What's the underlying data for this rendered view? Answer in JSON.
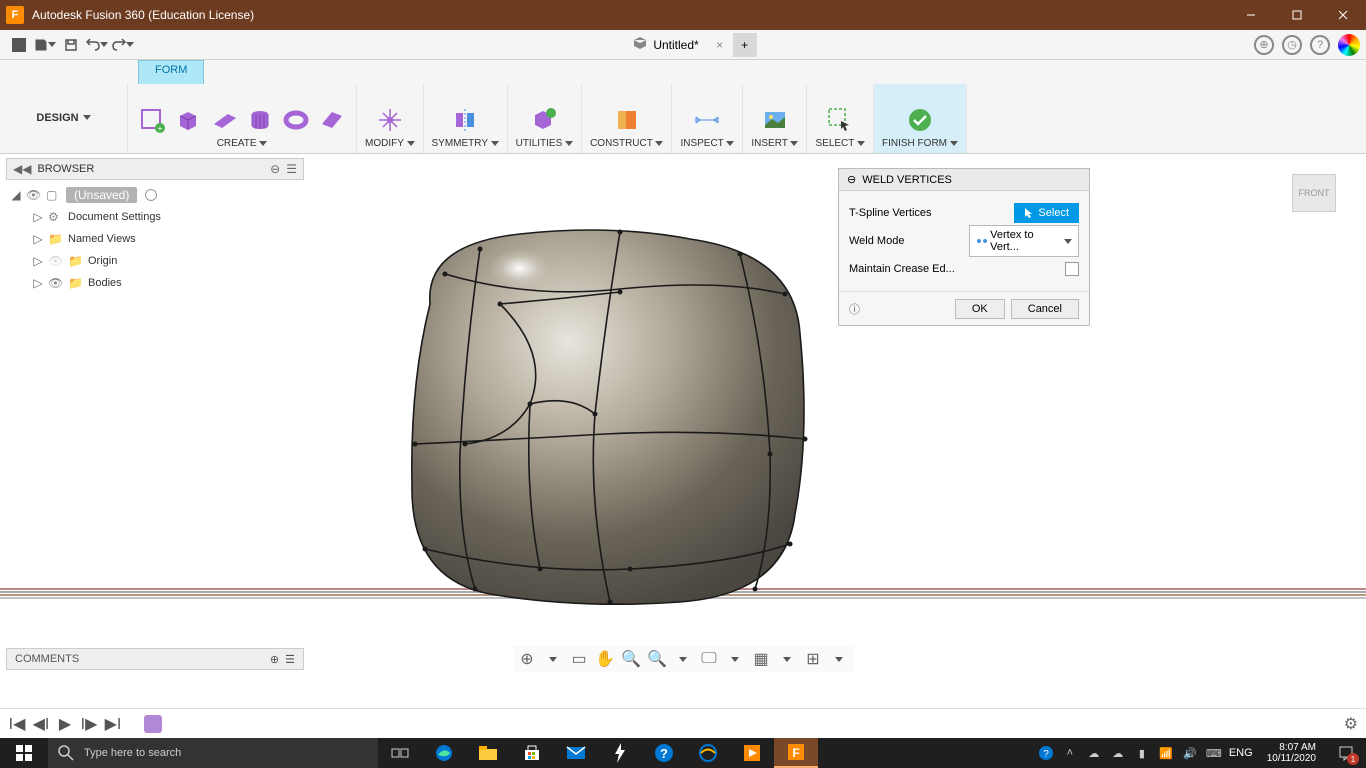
{
  "window": {
    "title": "Autodesk Fusion 360 (Education License)"
  },
  "qab": {
    "file_tab": "Untitled*"
  },
  "tabs": {
    "active": "FORM"
  },
  "ribbon": {
    "design": "DESIGN",
    "create": "CREATE",
    "modify": "MODIFY",
    "symmetry": "SYMMETRY",
    "utilities": "UTILITIES",
    "construct": "CONSTRUCT",
    "inspect": "INSPECT",
    "insert": "INSERT",
    "select": "SELECT",
    "finish": "FINISH FORM"
  },
  "browser": {
    "title": "BROWSER",
    "root": "(Unsaved)",
    "items": [
      {
        "name": "Document Settings"
      },
      {
        "name": "Named Views"
      },
      {
        "name": "Origin"
      },
      {
        "name": "Bodies"
      }
    ]
  },
  "dialog": {
    "title": "WELD VERTICES",
    "rows": {
      "tspline": "T-Spline Vertices",
      "select_btn": "Select",
      "weldmode": "Weld Mode",
      "weldmode_value": "Vertex to Vert...",
      "maintain": "Maintain Crease Ed..."
    },
    "ok": "OK",
    "cancel": "Cancel"
  },
  "viewcube": {
    "face": "FRONT"
  },
  "comments": {
    "title": "COMMENTS"
  },
  "taskbar": {
    "search_placeholder": "Type here to search",
    "lang": "ENG",
    "time": "8:07 AM",
    "date": "10/11/2020",
    "notif_count": "1"
  }
}
